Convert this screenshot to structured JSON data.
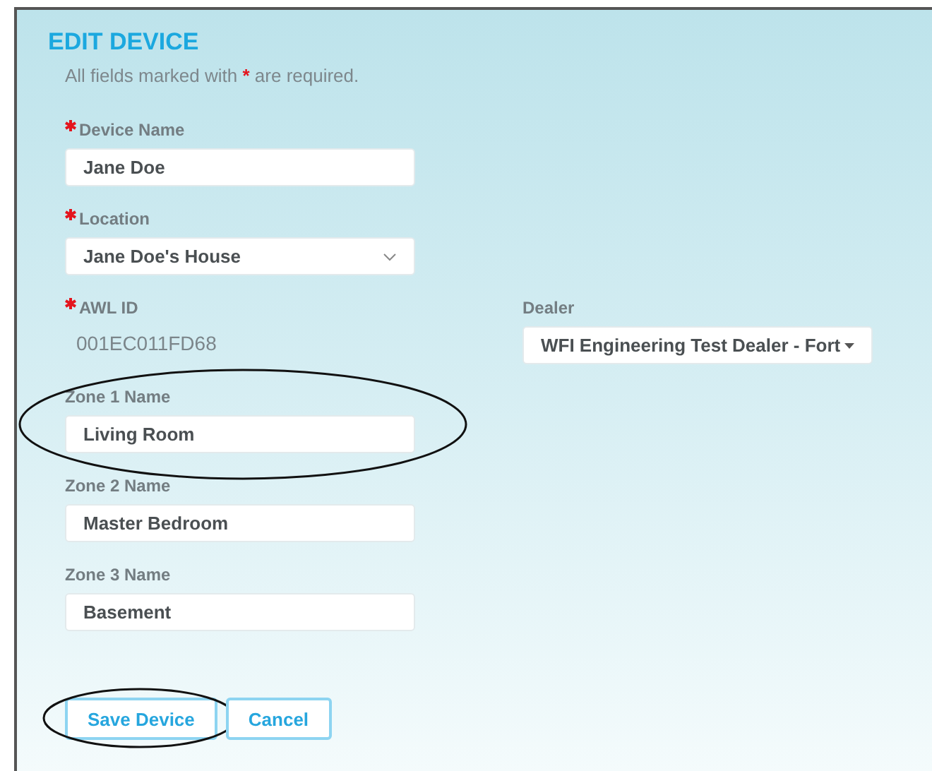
{
  "title": "EDIT DEVICE",
  "note": {
    "before": "All fields marked with",
    "mark": "*",
    "after": "are required."
  },
  "rows": [
    {
      "fields": [
        {
          "kind": "text",
          "label": "Device Name",
          "required": true,
          "value": "Jane Doe",
          "highlighted": false
        }
      ]
    },
    {
      "fields": [
        {
          "kind": "select",
          "label": "Location",
          "required": true,
          "value": "Jane Doe's House",
          "highlighted": false
        }
      ]
    },
    {
      "fields": [
        {
          "kind": "readonly",
          "label": "AWL ID",
          "required": true,
          "value": "001EC011FD68",
          "highlighted": false
        },
        {
          "kind": "dropdown",
          "label": "Dealer",
          "required": false,
          "value": "WFI Engineering Test Dealer - Fort",
          "highlighted": false
        }
      ]
    },
    {
      "fields": [
        {
          "kind": "text",
          "label": "Zone 1 Name",
          "required": false,
          "value": "Living Room",
          "highlighted": true
        }
      ]
    },
    {
      "fields": [
        {
          "kind": "text",
          "label": "Zone 2 Name",
          "required": false,
          "value": "Master Bedroom",
          "highlighted": false
        }
      ]
    },
    {
      "fields": [
        {
          "kind": "text",
          "label": "Zone 3 Name",
          "required": false,
          "value": "Basement",
          "highlighted": false
        }
      ]
    }
  ],
  "buttons": [
    {
      "label": "Save Device",
      "highlighted": true
    },
    {
      "label": "Cancel",
      "highlighted": false
    }
  ]
}
